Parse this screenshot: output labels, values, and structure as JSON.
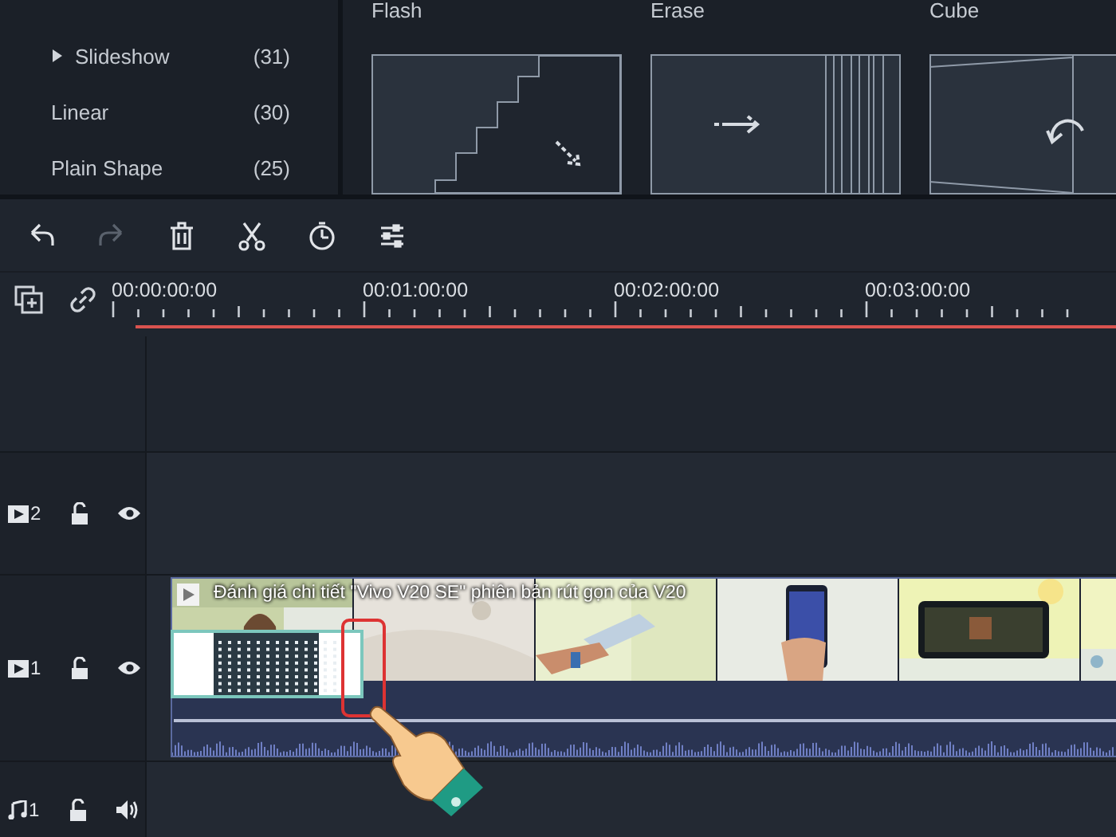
{
  "sidebar": {
    "items": [
      {
        "label": "Slideshow",
        "count": "(31)",
        "kind": "group",
        "expanded": false
      },
      {
        "label": "Linear",
        "count": "(30)",
        "kind": "item"
      },
      {
        "label": "Plain Shape",
        "count": "(25)",
        "kind": "item"
      }
    ]
  },
  "transitions": [
    {
      "label": "Flash",
      "kind": "flash"
    },
    {
      "label": "Erase",
      "kind": "erase"
    },
    {
      "label": "Cube",
      "kind": "cube"
    }
  ],
  "toolbar": [
    {
      "kind": "undo",
      "disabled": false
    },
    {
      "kind": "redo",
      "disabled": true
    },
    {
      "kind": "delete",
      "disabled": false
    },
    {
      "kind": "cut",
      "disabled": false
    },
    {
      "kind": "speed",
      "disabled": false
    },
    {
      "kind": "adjust",
      "disabled": false
    }
  ],
  "ruler": {
    "ticks": [
      "00:00:00:00",
      "00:01:00:00",
      "00:02:00:00",
      "00:03:00:00"
    ]
  },
  "tracks": [
    {
      "kind": "empty"
    },
    {
      "kind": "video",
      "number": "2",
      "locked": false,
      "visible": true
    },
    {
      "kind": "video",
      "number": "1",
      "locked": false,
      "visible": true
    },
    {
      "kind": "audio",
      "number": "1",
      "locked": false,
      "muted": false
    }
  ],
  "clip": {
    "title": "Đánh giá chi tiết \"Vivo V20 SE\" phiên bản rút gọn của V20"
  }
}
